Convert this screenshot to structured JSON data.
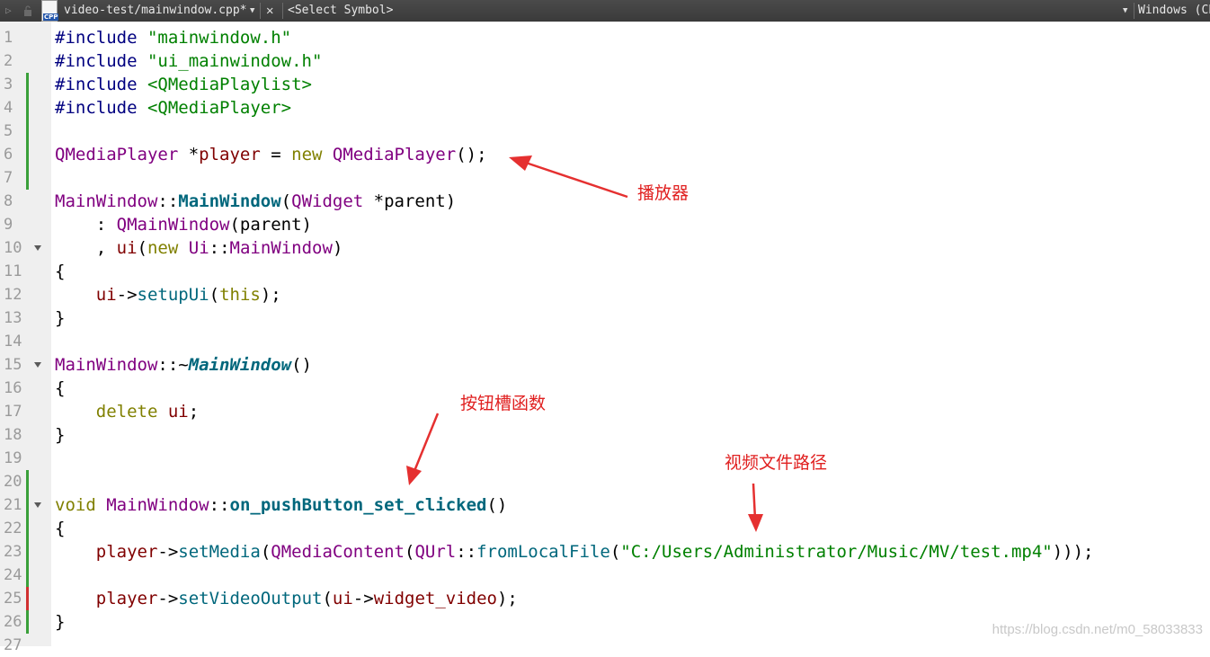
{
  "toolbar": {
    "file_tab": "video-test/mainwindow.cpp*",
    "file_icon_label": "CPP",
    "symbol_select": "<Select Symbol>",
    "encoding": "Windows (CP"
  },
  "editor": {
    "line_numbers": [
      "1",
      "2",
      "3",
      "4",
      "5",
      "6",
      "7",
      "8",
      "9",
      "10",
      "11",
      "12",
      "13",
      "14",
      "15",
      "16",
      "17",
      "18",
      "19",
      "20",
      "21",
      "22",
      "23",
      "24",
      "25",
      "26",
      "27"
    ],
    "lines": [
      [
        {
          "c": "pp",
          "t": "#include "
        },
        {
          "c": "str",
          "t": "\"mainwindow.h\""
        }
      ],
      [
        {
          "c": "pp",
          "t": "#include "
        },
        {
          "c": "str",
          "t": "\"ui_mainwindow.h\""
        }
      ],
      [
        {
          "c": "pp",
          "t": "#include "
        },
        {
          "c": "str",
          "t": "<QMediaPlaylist>"
        }
      ],
      [
        {
          "c": "pp",
          "t": "#include "
        },
        {
          "c": "str",
          "t": "<QMediaPlayer>"
        }
      ],
      [],
      [
        {
          "c": "ty",
          "t": "QMediaPlayer"
        },
        {
          "c": "",
          "t": " *"
        },
        {
          "c": "var",
          "t": "player"
        },
        {
          "c": "",
          "t": " = "
        },
        {
          "c": "kw",
          "t": "new"
        },
        {
          "c": "",
          "t": " "
        },
        {
          "c": "ty",
          "t": "QMediaPlayer"
        },
        {
          "c": "",
          "t": "();"
        }
      ],
      [],
      [
        {
          "c": "ty",
          "t": "MainWindow"
        },
        {
          "c": "",
          "t": "::"
        },
        {
          "c": "fnb",
          "t": "MainWindow"
        },
        {
          "c": "",
          "t": "("
        },
        {
          "c": "ty",
          "t": "QWidget"
        },
        {
          "c": "",
          "t": " *parent)"
        }
      ],
      [
        {
          "c": "",
          "t": "    : "
        },
        {
          "c": "ty",
          "t": "QMainWindow"
        },
        {
          "c": "",
          "t": "(parent)"
        }
      ],
      [
        {
          "c": "",
          "t": "    , "
        },
        {
          "c": "var",
          "t": "ui"
        },
        {
          "c": "",
          "t": "("
        },
        {
          "c": "kw",
          "t": "new"
        },
        {
          "c": "",
          "t": " "
        },
        {
          "c": "ty",
          "t": "Ui"
        },
        {
          "c": "",
          "t": "::"
        },
        {
          "c": "ty",
          "t": "MainWindow"
        },
        {
          "c": "",
          "t": ")"
        }
      ],
      [
        {
          "c": "",
          "t": "{"
        }
      ],
      [
        {
          "c": "",
          "t": "    "
        },
        {
          "c": "var",
          "t": "ui"
        },
        {
          "c": "",
          "t": "->"
        },
        {
          "c": "fn",
          "t": "setupUi"
        },
        {
          "c": "",
          "t": "("
        },
        {
          "c": "kw",
          "t": "this"
        },
        {
          "c": "",
          "t": ");"
        }
      ],
      [
        {
          "c": "",
          "t": "}"
        }
      ],
      [],
      [
        {
          "c": "ty",
          "t": "MainWindow"
        },
        {
          "c": "",
          "t": "::~"
        },
        {
          "c": "fnbi",
          "t": "MainWindow"
        },
        {
          "c": "",
          "t": "()"
        }
      ],
      [
        {
          "c": "",
          "t": "{"
        }
      ],
      [
        {
          "c": "",
          "t": "    "
        },
        {
          "c": "kw",
          "t": "delete"
        },
        {
          "c": "",
          "t": " "
        },
        {
          "c": "var",
          "t": "ui"
        },
        {
          "c": "",
          "t": ";"
        }
      ],
      [
        {
          "c": "",
          "t": "}"
        }
      ],
      [],
      [],
      [
        {
          "c": "kw",
          "t": "void"
        },
        {
          "c": "",
          "t": " "
        },
        {
          "c": "ty",
          "t": "MainWindow"
        },
        {
          "c": "",
          "t": "::"
        },
        {
          "c": "fnb",
          "t": "on_pushButton_set_clicked"
        },
        {
          "c": "",
          "t": "()"
        }
      ],
      [
        {
          "c": "",
          "t": "{"
        }
      ],
      [
        {
          "c": "",
          "t": "    "
        },
        {
          "c": "var",
          "t": "player"
        },
        {
          "c": "",
          "t": "->"
        },
        {
          "c": "fn",
          "t": "setMedia"
        },
        {
          "c": "",
          "t": "("
        },
        {
          "c": "ty",
          "t": "QMediaContent"
        },
        {
          "c": "",
          "t": "("
        },
        {
          "c": "ty",
          "t": "QUrl"
        },
        {
          "c": "",
          "t": "::"
        },
        {
          "c": "fn",
          "t": "fromLocalFile"
        },
        {
          "c": "",
          "t": "("
        },
        {
          "c": "str",
          "t": "\"C:/Users/Administrator/Music/MV/test.mp4\""
        },
        {
          "c": "",
          "t": ")));"
        }
      ],
      [],
      [
        {
          "c": "",
          "t": "    "
        },
        {
          "c": "var",
          "t": "player"
        },
        {
          "c": "",
          "t": "->"
        },
        {
          "c": "fn",
          "t": "setVideoOutput"
        },
        {
          "c": "",
          "t": "("
        },
        {
          "c": "var",
          "t": "ui"
        },
        {
          "c": "",
          "t": "->"
        },
        {
          "c": "var",
          "t": "widget_video"
        },
        {
          "c": "",
          "t": ");"
        }
      ],
      [
        {
          "c": "",
          "t": "}"
        }
      ],
      []
    ]
  },
  "annotations": {
    "player": "播放器",
    "slot": "按钮槽函数",
    "path": "视频文件路径"
  },
  "watermark": "https://blog.csdn.net/m0_58033833",
  "colors": {
    "annotation": "#e02020",
    "change_marker_green": "#3aa03a",
    "change_marker_red": "#d03030"
  }
}
